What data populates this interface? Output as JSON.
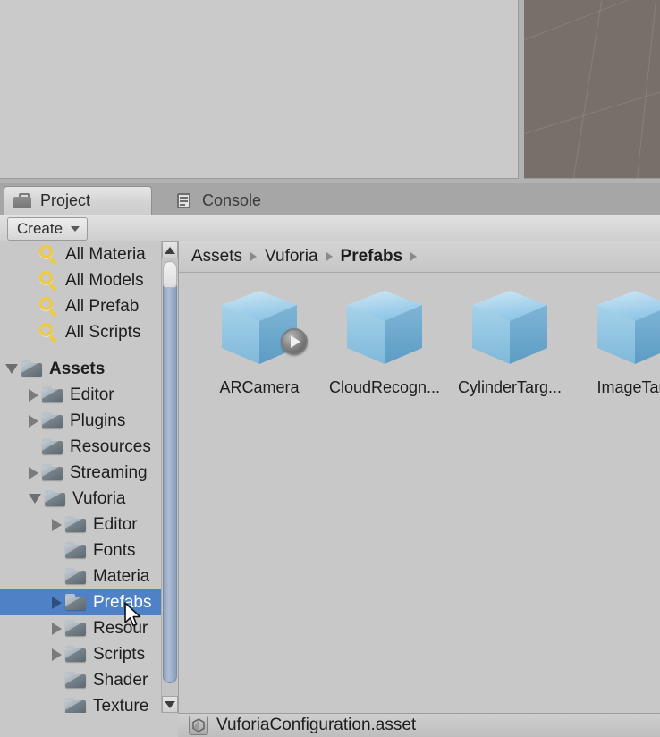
{
  "window": {
    "scene_view_label": "",
    "panel_bg": "#c8c8c8",
    "selection_color": "#4f81c7",
    "scene_right_color": "#776f6a"
  },
  "tabs": [
    {
      "label": "Project",
      "icon": "project-folder-icon",
      "active": true
    },
    {
      "label": "Console",
      "icon": "console-document-icon",
      "active": false
    }
  ],
  "toolbar": {
    "create_label": "Create",
    "create_caret_icon": "chevron-down-icon"
  },
  "tree": {
    "searches": [
      {
        "label": "All Materia",
        "icon": "search-icon"
      },
      {
        "label": "All Models",
        "icon": "search-icon"
      },
      {
        "label": "All Prefab",
        "icon": "search-icon"
      },
      {
        "label": "All Scripts",
        "icon": "search-icon"
      }
    ],
    "folders": [
      {
        "label": "Assets",
        "indent": 0,
        "twisty": "open",
        "bold": true,
        "selected": false
      },
      {
        "label": "Editor",
        "indent": 1,
        "twisty": "closed",
        "bold": false,
        "selected": false
      },
      {
        "label": "Plugins",
        "indent": 1,
        "twisty": "closed",
        "bold": false,
        "selected": false
      },
      {
        "label": "Resources",
        "indent": 1,
        "twisty": "none",
        "bold": false,
        "selected": false
      },
      {
        "label": "Streaming",
        "indent": 1,
        "twisty": "closed",
        "bold": false,
        "selected": false
      },
      {
        "label": "Vuforia",
        "indent": 1,
        "twisty": "open",
        "bold": false,
        "selected": false
      },
      {
        "label": "Editor",
        "indent": 2,
        "twisty": "closed",
        "bold": false,
        "selected": false
      },
      {
        "label": "Fonts",
        "indent": 2,
        "twisty": "none",
        "bold": false,
        "selected": false
      },
      {
        "label": "Materia",
        "indent": 2,
        "twisty": "none",
        "bold": false,
        "selected": false
      },
      {
        "label": "Prefabs",
        "indent": 2,
        "twisty": "closed",
        "bold": false,
        "selected": true
      },
      {
        "label": "Resour",
        "indent": 2,
        "twisty": "closed",
        "bold": false,
        "selected": false
      },
      {
        "label": "Scripts",
        "indent": 2,
        "twisty": "closed",
        "bold": false,
        "selected": false
      },
      {
        "label": "Shader",
        "indent": 2,
        "twisty": "none",
        "bold": false,
        "selected": false
      },
      {
        "label": "Texture",
        "indent": 2,
        "twisty": "none",
        "bold": false,
        "selected": false
      }
    ]
  },
  "scrollbar": {
    "up_icon": "caret-up-icon",
    "down_icon": "caret-down-icon"
  },
  "breadcrumb": [
    {
      "label": "Assets",
      "current": false
    },
    {
      "label": "Vuforia",
      "current": false
    },
    {
      "label": "Prefabs",
      "current": true
    }
  ],
  "grid": {
    "items": [
      {
        "label": "ARCamera",
        "icon": "prefab-cube-icon",
        "has_badge": true
      },
      {
        "label": "CloudRecogn...",
        "icon": "prefab-cube-icon",
        "has_badge": false
      },
      {
        "label": "CylinderTarg...",
        "icon": "prefab-cube-icon",
        "has_badge": false
      },
      {
        "label": "ImageTarg",
        "icon": "prefab-cube-icon",
        "has_badge": false
      }
    ]
  },
  "statusbar": {
    "icon": "unity-asset-icon",
    "text": "VuforiaConfiguration.asset"
  }
}
